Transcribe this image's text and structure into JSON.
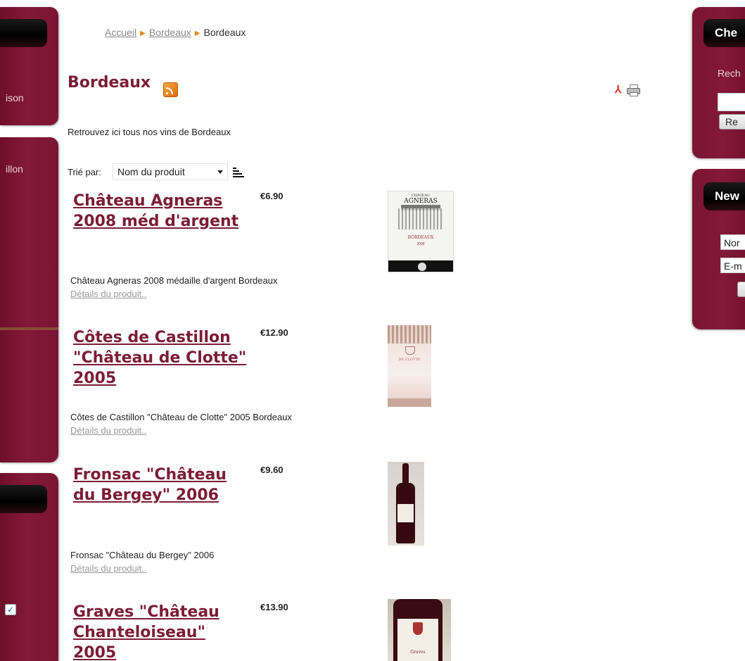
{
  "left_sidebar": {
    "panel1_text": "ison",
    "panel2_text": "illon"
  },
  "right_sidebar": {
    "search": {
      "title": "Che",
      "label": "Rech",
      "button": "Re"
    },
    "newsletter": {
      "title": "New",
      "name_placeholder": "Nor",
      "email_placeholder": "E-m"
    }
  },
  "breadcrumb": {
    "items": [
      "Accueil",
      "Bordeaux"
    ],
    "current": "Bordeaux"
  },
  "page": {
    "title": "Bordeaux",
    "intro": "Retrouvez ici tous nos vins de Bordeaux"
  },
  "sort": {
    "label": "Trié par:",
    "selected": "Nom du produit"
  },
  "products": [
    {
      "name": "Château Agneras 2008 méd d'argent",
      "price": "€6.90",
      "description": "Château Agneras 2008 médaille d'argent Bordeaux",
      "details_link": "Détails du produit..",
      "label_top": "CHÂTEAU",
      "label_name": "AGNERAS",
      "label_region": "BORDEAUX",
      "label_year": "2008"
    },
    {
      "name": "Côtes de Castillon \"Château de Clotte\" 2005",
      "price": "€12.90",
      "description": "Côtes de Castillon \"Château de Clotte\" 2005 Bordeaux",
      "details_link": "Détails du produit..",
      "label_name": "DE CLOTTE"
    },
    {
      "name": "Fronsac \"Château du Bergey\" 2006",
      "price": "€9.60",
      "description": "Fronsac \"Château du Bergey\" 2006",
      "details_link": "Détails du produit.."
    },
    {
      "name": "Graves \"Château Chanteloiseau\" 2005",
      "price": "€13.90",
      "label_text": "Graves"
    }
  ]
}
